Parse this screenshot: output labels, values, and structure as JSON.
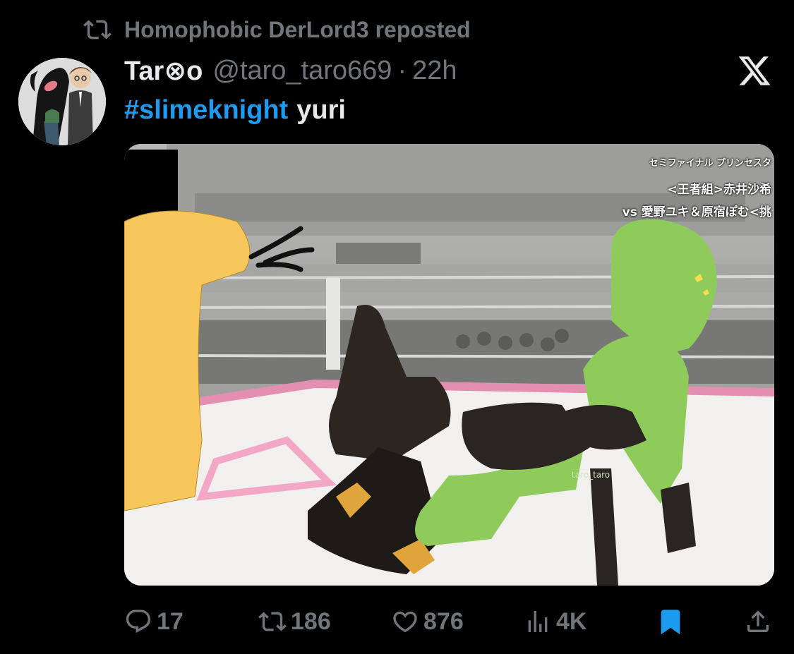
{
  "repost_banner": {
    "text": "Homophobic DerLord3 reposted",
    "icon": "repost-icon"
  },
  "tweet": {
    "author_name": "Tar⊗o",
    "handle": "@taro_taro669",
    "separator": "·",
    "time": "22h",
    "hashtag": "#slimeknight",
    "text": "yuri"
  },
  "media": {
    "caption_line1": "セミファイナル プリンセスタ",
    "caption_line2": "<王者組>赤井沙希",
    "caption_line3": "vs 愛野ユキ＆原宿ぽむ<挑",
    "watermark": "taro_taro"
  },
  "actions": {
    "replies": "17",
    "reposts": "186",
    "likes": "876",
    "views": "4K"
  },
  "colors": {
    "accent": "#1d9bf0",
    "muted": "#71767b",
    "background": "#000000",
    "text": "#e7e9ea"
  }
}
